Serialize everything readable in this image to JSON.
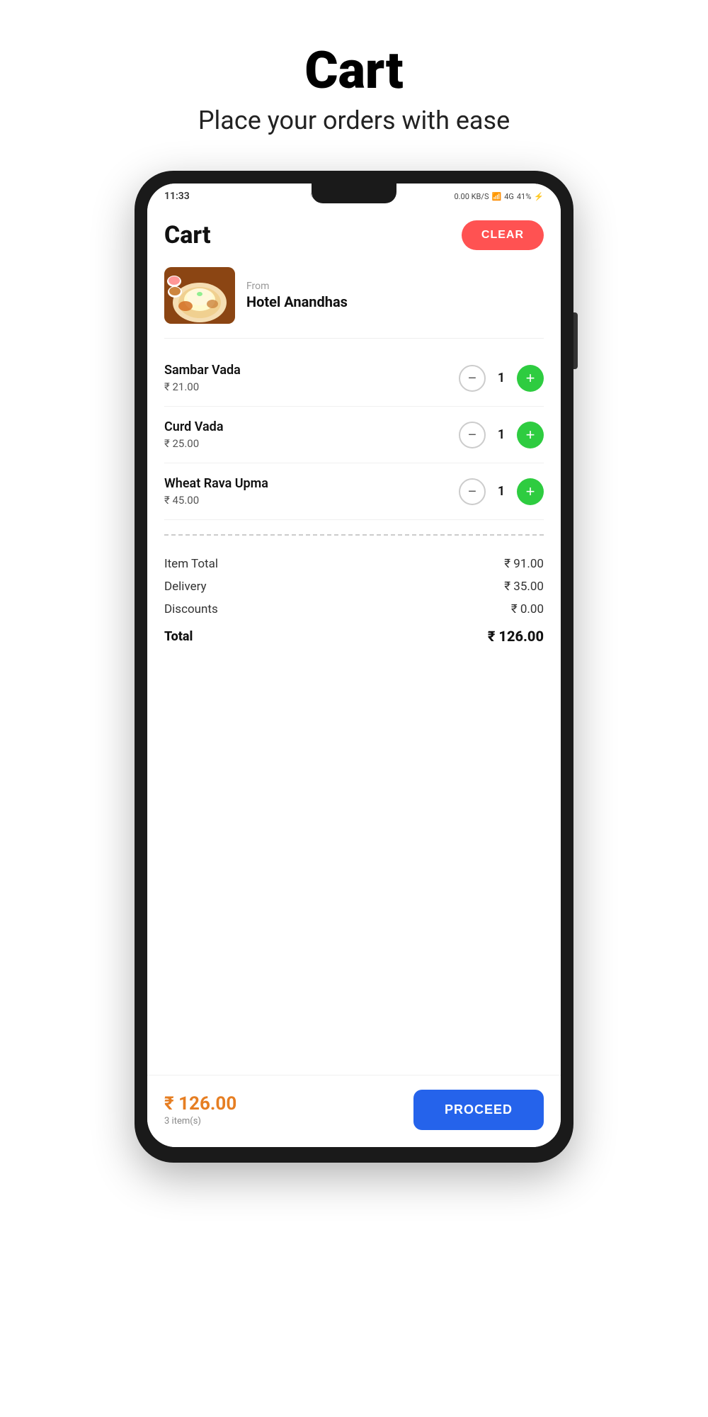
{
  "page": {
    "title": "Cart",
    "subtitle": "Place your orders with ease"
  },
  "statusBar": {
    "time": "11:33",
    "battery": "41%",
    "signal": "4G"
  },
  "cart": {
    "title": "Cart",
    "clearButton": "CLEAR",
    "restaurant": {
      "fromLabel": "From",
      "name": "Hotel Anandhas"
    },
    "items": [
      {
        "name": "Sambar Vada",
        "price": "₹ 21.00",
        "quantity": "1"
      },
      {
        "name": "Curd Vada",
        "price": "₹ 25.00",
        "quantity": "1"
      },
      {
        "name": "Wheat Rava Upma",
        "price": "₹ 45.00",
        "quantity": "1"
      }
    ],
    "summary": {
      "itemTotalLabel": "Item Total",
      "itemTotalValue": "₹ 91.00",
      "deliveryLabel": "Delivery",
      "deliveryValue": "₹ 35.00",
      "discountsLabel": "Discounts",
      "discountsValue": "₹ 0.00",
      "totalLabel": "Total",
      "totalValue": "₹ 126.00"
    },
    "bottomBar": {
      "totalAmount": "₹ 126.00",
      "itemCount": "3 item(s)",
      "proceedButton": "PROCEED"
    }
  }
}
